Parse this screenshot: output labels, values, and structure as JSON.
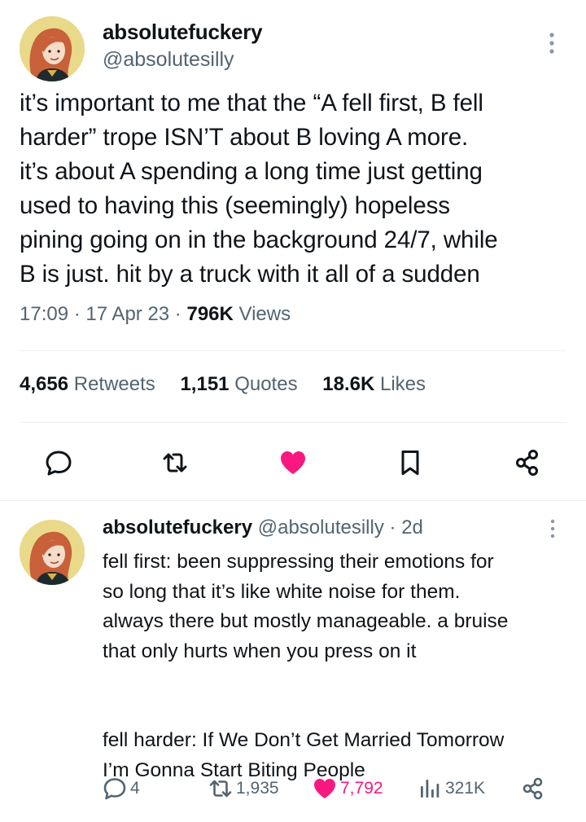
{
  "main_tweet": {
    "display_name": "absolutefuckery",
    "handle": "@absolutesilly",
    "text_lines": [
      "it’s important to me that the “A fell first, B fell",
      "harder” trope ISN’T about B loving A more.",
      "it’s about A spending a long time just getting",
      "used to having this (seemingly) hopeless",
      "pining going on in the background 24/7, while",
      "B is just. hit by a truck with it all of a sudden"
    ],
    "time": "17:09",
    "date": "17 Apr 23",
    "views_count": "796K",
    "views_label": "Views",
    "separator": " · ",
    "stats": {
      "retweets_count": "4,656",
      "retweets_label": "Retweets",
      "quotes_count": "1,151",
      "quotes_label": "Quotes",
      "likes_count": "18.6K",
      "likes_label": "Likes"
    },
    "actions": [
      "reply-icon",
      "retweet-icon",
      "like-icon-filled",
      "bookmark-icon",
      "share-icon"
    ],
    "liked": true
  },
  "reply_tweet": {
    "display_name": "absolutefuckery",
    "handle": "@absolutesilly",
    "separator": "·",
    "time_ago": "2d",
    "text_lines_1": [
      "fell first: been suppressing their emotions for",
      "so long that it’s like white noise for them.",
      "always there but mostly manageable. a bruise",
      "that only hurts when you press on it"
    ],
    "text_lines_2": [
      "fell harder: If We Don’t Get Married Tomorrow",
      "I’m Gonna Start Biting People"
    ],
    "replies": "4",
    "retweets": "1,935",
    "likes": "7,792",
    "views": "321K"
  },
  "colors": {
    "text_primary": "#0f1419",
    "text_secondary": "#536471",
    "like_pink": "#f91880",
    "divider": "#eff3f4",
    "avatar_bg": "#e9d98a"
  }
}
